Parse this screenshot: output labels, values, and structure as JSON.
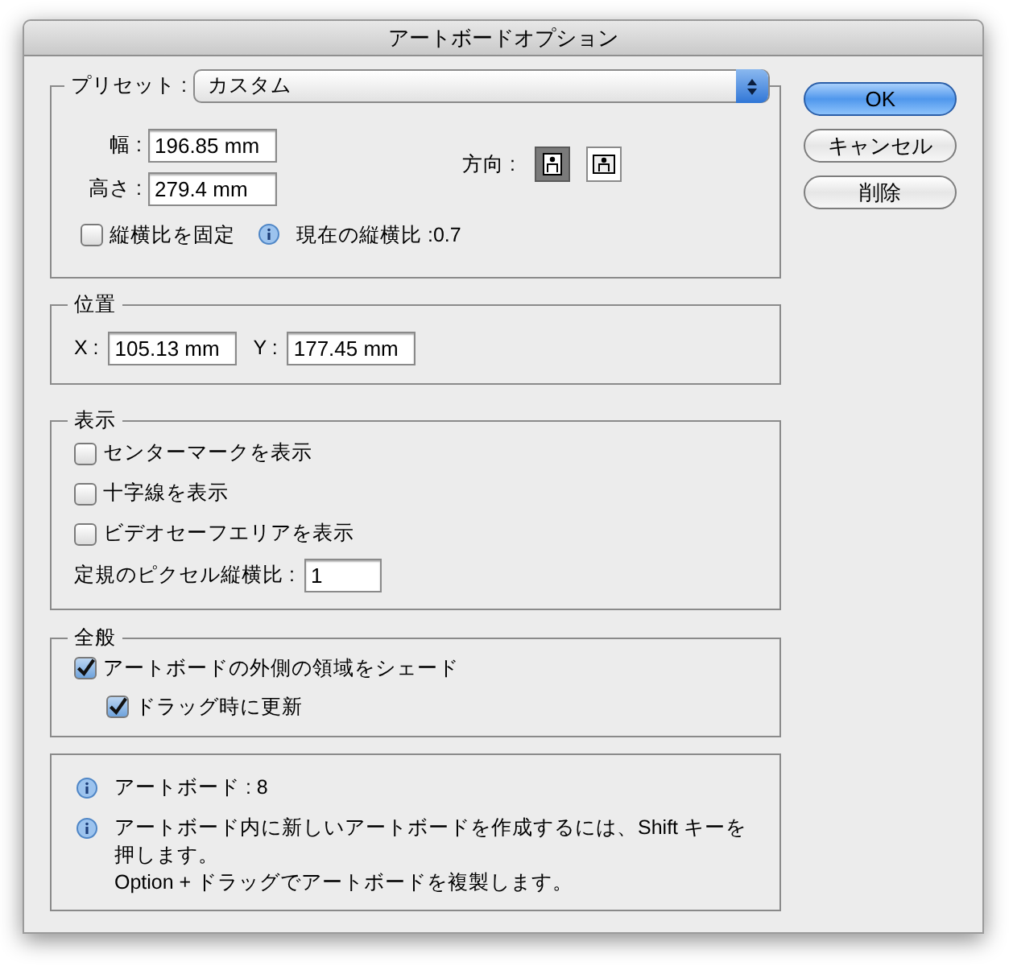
{
  "window": {
    "title": "アートボードオプション"
  },
  "preset": {
    "label": "プリセット :",
    "value": "カスタム",
    "width": {
      "label": "幅 :",
      "value": "196.85 mm"
    },
    "height": {
      "label": "高さ :",
      "value": "279.4 mm"
    },
    "orientation": {
      "label": "方向 :",
      "options": [
        {
          "kind": "portrait",
          "selected": true
        },
        {
          "kind": "landscape",
          "selected": false
        }
      ]
    },
    "constrain": {
      "label": "縦横比を固定",
      "checked": false
    },
    "current_ratio": "現在の縦横比 :0.7"
  },
  "position": {
    "title": "位置",
    "x": {
      "label": "X :",
      "value": "105.13 mm"
    },
    "y": {
      "label": "Y :",
      "value": "177.45 mm"
    }
  },
  "display": {
    "title": "表示",
    "options": [
      {
        "label": "センターマークを表示",
        "checked": false
      },
      {
        "label": "十字線を表示",
        "checked": false
      },
      {
        "label": "ビデオセーフエリアを表示",
        "checked": false
      }
    ],
    "pixel_ratio": {
      "label": "定規のピクセル縦横比 :",
      "value": "1"
    }
  },
  "general": {
    "title": "全般",
    "options": [
      {
        "label": "アートボードの外側の領域をシェード",
        "checked": true,
        "children": [
          {
            "label": "ドラッグ時に更新",
            "checked": true
          }
        ]
      }
    ]
  },
  "info": [
    {
      "lines": [
        "アートボード : 8"
      ]
    },
    {
      "lines": [
        "アートボード内に新しいアートボードを作成するには、Shift キーを押します。",
        "Option + ドラッグでアートボードを複製します。"
      ]
    }
  ],
  "buttons": [
    {
      "label": "OK",
      "kind": "default"
    },
    {
      "label": "キャンセル",
      "kind": "normal"
    },
    {
      "label": "削除",
      "kind": "normal"
    }
  ]
}
